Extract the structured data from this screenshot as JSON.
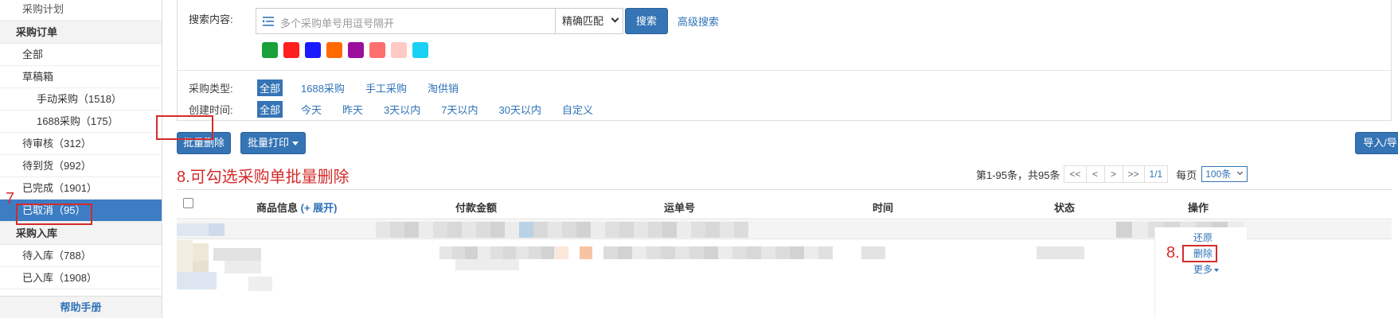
{
  "sidebar": {
    "top_item": "采购计划",
    "group_orders": "采购订单",
    "all": "全部",
    "drafts": "草稿箱",
    "manual": "手动采购（1518）",
    "ali1688": "1688采购（175）",
    "pending_review": "待审核（312）",
    "pending_arrival": "待到货（992）",
    "completed": "已完成（1901）",
    "cancelled": "已取消（95）",
    "group_inbound": "采购入库",
    "pending_inbound": "待入库（788）",
    "done_inbound": "已入库（1908）",
    "help": "帮助手册",
    "step_marker": "7"
  },
  "search": {
    "label": "搜索内容:",
    "placeholder": "多个采购单号用逗号隔开",
    "match_mode": "精确匹配",
    "search_button": "搜索",
    "advanced": "高级搜索",
    "colors": [
      "#1aa039",
      "#ff1f1f",
      "#1a1aff",
      "#ff6a00",
      "#9b0e9b",
      "#ff6f6f",
      "#ffc9c4",
      "#19d1f4"
    ]
  },
  "filters": {
    "type_label": "采购类型:",
    "types": [
      "全部",
      "1688采购",
      "手工采购",
      "淘供销"
    ],
    "time_label": "创建时间:",
    "times": [
      "全部",
      "今天",
      "昨天",
      "3天以内",
      "7天以内",
      "30天以内",
      "自定义"
    ]
  },
  "toolbar": {
    "batch_delete": "批量删除",
    "batch_print": "批量打印",
    "import_export": "导入/导出"
  },
  "annotation": {
    "hint": "8.可勾选采购单批量删除",
    "step8": "8."
  },
  "pager": {
    "summary": "第1-95条，共95条",
    "first": "<<",
    "prev": "<",
    "next": ">",
    "last": ">>",
    "page": "1/1",
    "per_label": "每页",
    "per_value": "100条"
  },
  "table": {
    "col_product": "商品信息",
    "expand": "(+ 展开)",
    "col_amount": "付款金额",
    "col_tracking": "运单号",
    "col_time": "时间",
    "col_status": "状态",
    "col_ops": "操作"
  },
  "row_ops": {
    "restore": "还原",
    "delete": "删除",
    "more": "更多"
  }
}
